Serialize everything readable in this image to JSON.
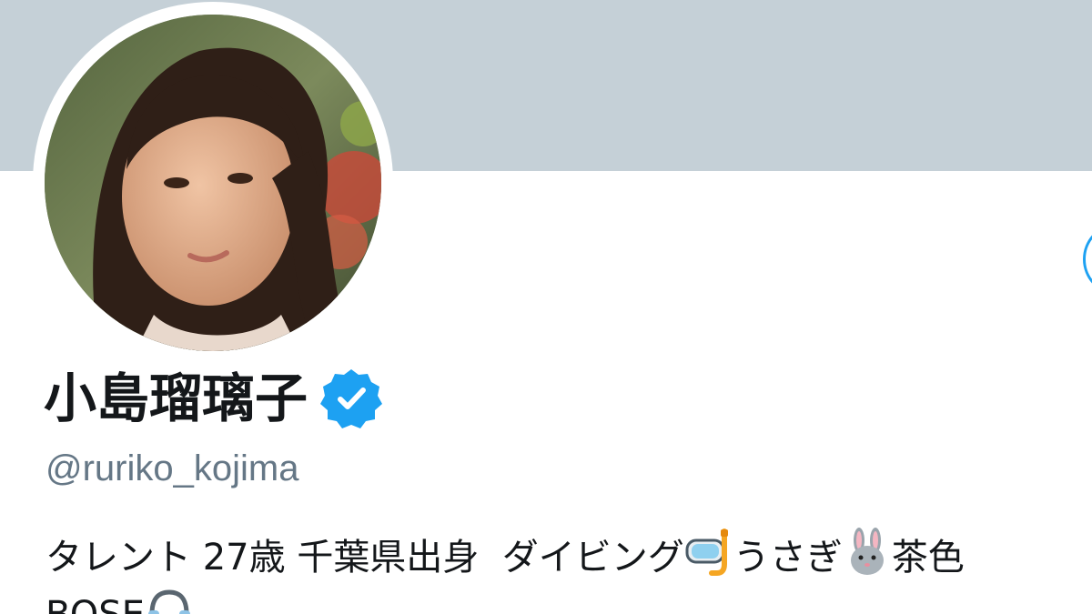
{
  "profile": {
    "display_name": "小島瑠璃子",
    "handle": "@ruriko_kojima",
    "verified": true,
    "bio": {
      "line1": "タレント 27歳 千葉県出身  ダイビング",
      "line1_b": "うさぎ",
      "line1_c": "茶色",
      "line2": "BOSE"
    }
  },
  "icons": {
    "verified": "verified-badge-icon",
    "diving": "diving-mask-emoji",
    "rabbit": "rabbit-emoji",
    "music": "headphones-emoji"
  },
  "colors": {
    "banner": "#c5d0d7",
    "verified": "#1da1f2",
    "handle": "#657786",
    "text": "#14171a"
  }
}
